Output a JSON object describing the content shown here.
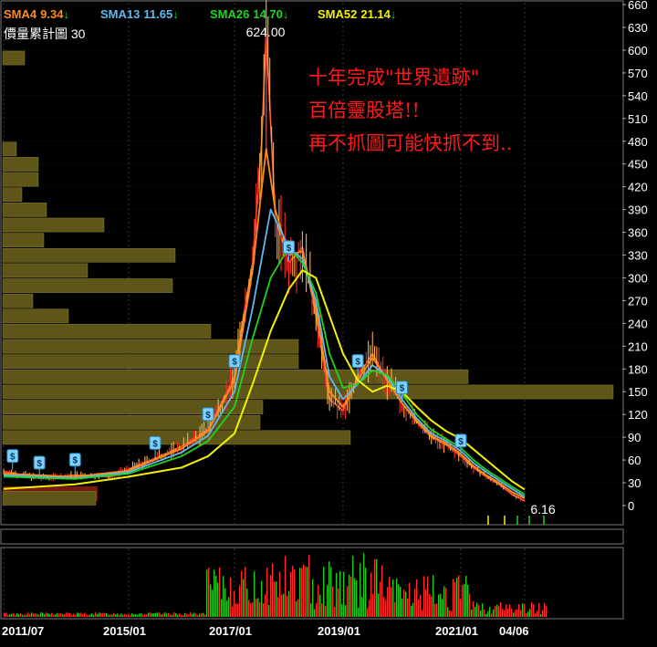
{
  "indicators": {
    "sma4": {
      "label": "SMA4",
      "value": "9.34",
      "arrow": "↓",
      "color": "#ff8c1a"
    },
    "sma13": {
      "label": "SMA13",
      "value": "11.65",
      "arrow": "↓",
      "color": "#5fb8f0"
    },
    "sma26": {
      "label": "SMA26",
      "value": "14.70",
      "arrow": "↓",
      "color": "#1ed41e"
    },
    "sma52": {
      "label": "SMA52",
      "value": "21.14",
      "arrow": "↓",
      "color": "#f2f200"
    }
  },
  "volume_profile_label": "價量累計圖 30",
  "annotation": {
    "line1": "十年完成\"世界遺跡\"",
    "line2": "百倍靈股塔!!",
    "line3": "再不抓圖可能快抓不到.."
  },
  "colors": {
    "background": "#000000",
    "up": "#ff2a2a",
    "down": "#1ec81e",
    "volume_profile": "#5e5618",
    "volume_profile_edge": "#8a8030",
    "bottom_band": "#7a1a0a",
    "grid": "#3a3a3a",
    "annotation": "#ff1a1a",
    "dividend_marker": "#5fb8f0"
  },
  "chart_data": {
    "type": "line",
    "y_axis": {
      "ticks": [
        "660",
        "630",
        "600",
        "570",
        "540",
        "510",
        "480",
        "450",
        "420",
        "390",
        "360",
        "330",
        "300",
        "270",
        "240",
        "210",
        "180",
        "150",
        "120",
        "90",
        "60",
        "30",
        "0"
      ],
      "range": [
        0,
        660
      ]
    },
    "x_axis": {
      "ticks": [
        "2011/07",
        "2015/01",
        "2017/01",
        "2019/01",
        "2021/01",
        "04/06"
      ]
    },
    "peak_label": "624.00",
    "last_label": "6.16",
    "price": {
      "x": [
        "2011/07",
        "2012/07",
        "2013/07",
        "2014/07",
        "2015/01",
        "2015/07",
        "2016/01",
        "2016/07",
        "2017/01",
        "2017/03",
        "2017/05",
        "2017/07",
        "2017/08",
        "2017/10",
        "2018/01",
        "2018/04",
        "2018/07",
        "2018/10",
        "2019/01",
        "2019/04",
        "2019/07",
        "2019/10",
        "2020/01",
        "2020/04",
        "2020/07",
        "2020/10",
        "2021/01",
        "2021/04",
        "2021/07",
        "2021/10",
        "2022/01",
        "2022/04"
      ],
      "values": [
        45,
        36,
        40,
        38,
        48,
        62,
        78,
        100,
        170,
        250,
        320,
        478,
        624,
        380,
        320,
        340,
        250,
        140,
        125,
        170,
        200,
        165,
        135,
        110,
        90,
        80,
        65,
        50,
        38,
        28,
        15,
        6.16
      ]
    },
    "series": [
      {
        "name": "SMA4",
        "color": "#ff8c1a",
        "x": [
          "2011/07",
          "2013/07",
          "2015/01",
          "2016/01",
          "2016/07",
          "2017/01",
          "2017/05",
          "2017/08",
          "2017/10",
          "2018/01",
          "2018/04",
          "2018/07",
          "2018/10",
          "2019/01",
          "2019/04",
          "2019/07",
          "2019/10",
          "2020/01",
          "2020/04",
          "2020/07",
          "2020/10",
          "2021/01",
          "2021/04",
          "2021/07",
          "2021/10",
          "2022/01",
          "2022/04"
        ],
        "values": [
          42,
          38,
          46,
          75,
          98,
          165,
          310,
          470,
          390,
          330,
          335,
          260,
          150,
          130,
          165,
          195,
          165,
          135,
          112,
          92,
          82,
          68,
          52,
          40,
          30,
          18,
          9.34
        ]
      },
      {
        "name": "SMA13",
        "color": "#5fb8f0",
        "x": [
          "2011/07",
          "2013/07",
          "2015/01",
          "2016/01",
          "2016/07",
          "2017/01",
          "2017/05",
          "2017/09",
          "2018/01",
          "2018/04",
          "2018/07",
          "2018/10",
          "2019/01",
          "2019/04",
          "2019/07",
          "2019/10",
          "2020/01",
          "2020/04",
          "2020/07",
          "2020/10",
          "2021/01",
          "2021/04",
          "2021/07",
          "2021/10",
          "2022/01",
          "2022/04"
        ],
        "values": [
          40,
          36,
          44,
          70,
          92,
          150,
          260,
          390,
          340,
          325,
          270,
          170,
          140,
          160,
          185,
          170,
          140,
          115,
          95,
          85,
          72,
          56,
          44,
          33,
          22,
          11.65
        ]
      },
      {
        "name": "SMA26",
        "color": "#1ed41e",
        "x": [
          "2011/07",
          "2013/07",
          "2015/01",
          "2016/01",
          "2016/07",
          "2017/01",
          "2017/05",
          "2017/09",
          "2018/01",
          "2018/04",
          "2018/07",
          "2018/10",
          "2019/01",
          "2019/04",
          "2019/07",
          "2019/10",
          "2020/01",
          "2020/04",
          "2020/07",
          "2020/10",
          "2021/01",
          "2021/04",
          "2021/07",
          "2021/10",
          "2022/01",
          "2022/04"
        ],
        "values": [
          38,
          35,
          42,
          65,
          85,
          130,
          220,
          300,
          340,
          320,
          280,
          200,
          155,
          160,
          178,
          172,
          148,
          120,
          100,
          88,
          76,
          60,
          47,
          36,
          25,
          14.7
        ]
      },
      {
        "name": "SMA52",
        "color": "#f2f200",
        "x": [
          "2011/07",
          "2013/07",
          "2015/01",
          "2016/01",
          "2016/07",
          "2017/01",
          "2017/05",
          "2017/09",
          "2018/01",
          "2018/04",
          "2018/07",
          "2018/10",
          "2019/01",
          "2019/04",
          "2019/07",
          "2019/10",
          "2020/01",
          "2020/04",
          "2020/07",
          "2020/10",
          "2021/01",
          "2021/04",
          "2021/07",
          "2021/10",
          "2022/01",
          "2022/04"
        ],
        "values": [
          22,
          28,
          38,
          50,
          65,
          95,
          160,
          230,
          285,
          310,
          300,
          250,
          200,
          165,
          150,
          158,
          150,
          130,
          112,
          98,
          88,
          74,
          60,
          46,
          32,
          21.14
        ]
      }
    ],
    "volume_profile": {
      "price_bins": [
        650,
        630,
        610,
        590,
        570,
        550,
        530,
        510,
        490,
        470,
        450,
        430,
        410,
        390,
        370,
        350,
        330,
        310,
        290,
        270,
        250,
        230,
        210,
        190,
        170,
        150,
        130,
        110,
        90,
        70,
        50,
        30,
        10
      ],
      "volumes": [
        0,
        0,
        0,
        8,
        0,
        0,
        0,
        0,
        0,
        5,
        13,
        13,
        7,
        16,
        37,
        15,
        63,
        31,
        62,
        11,
        24,
        76,
        108,
        108,
        170,
        223,
        95,
        94,
        127,
        0,
        0,
        0,
        34
      ]
    },
    "dividend_markers_x": [
      "2011/10",
      "2012/07",
      "2013/07",
      "2015/07",
      "2016/07",
      "2017/01",
      "2018/01",
      "2019/04",
      "2020/01",
      "2021/01"
    ]
  }
}
